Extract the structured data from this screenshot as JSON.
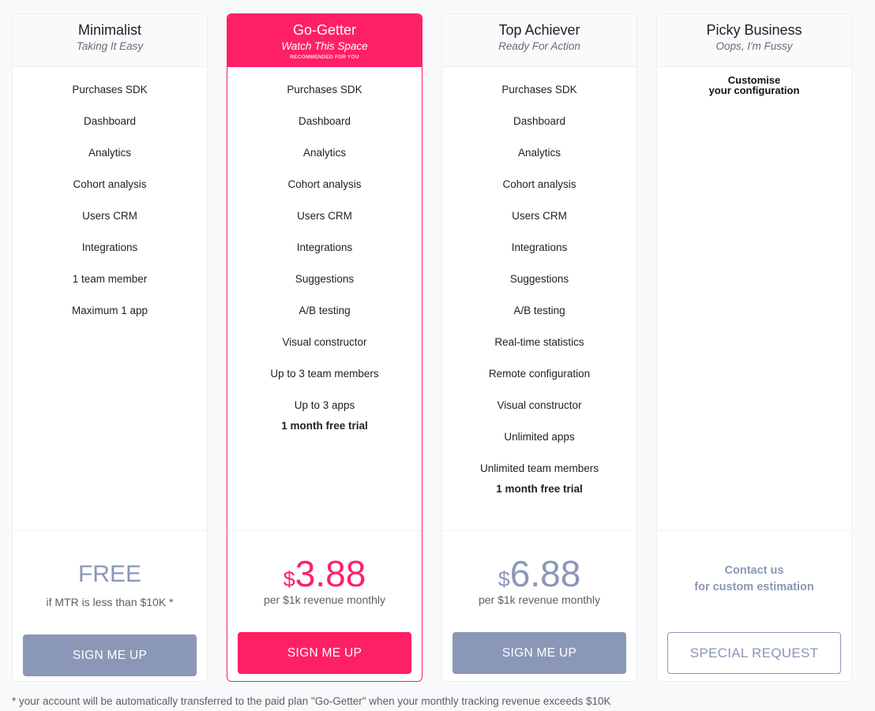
{
  "colors": {
    "accent": "#fe2065",
    "muted": "#8a97b6"
  },
  "plans": [
    {
      "name": "Minimalist",
      "tagline": "Taking It Easy",
      "features": [
        "Purchases SDK",
        "Dashboard",
        "Analytics",
        "Cohort analysis",
        "Users CRM",
        "Integrations",
        "1 team member",
        "Maximum 1 app"
      ],
      "price": "FREE",
      "price_note": "if MTR is less than $10K *",
      "button": "SIGN ME UP"
    },
    {
      "name": "Go-Getter",
      "tagline": "Watch This Space",
      "badge": "RECOMMENDED FOR YOU",
      "features": [
        "Purchases SDK",
        "Dashboard",
        "Analytics",
        "Cohort analysis",
        "Users CRM",
        "Integrations",
        "Suggestions",
        "A/B testing",
        "Visual constructor",
        "Up to 3 team members",
        "Up to 3 apps"
      ],
      "trial": "1 month free trial",
      "currency": "$",
      "price": "3.88",
      "price_note": "per $1k revenue monthly",
      "button": "SIGN ME UP"
    },
    {
      "name": "Top Achiever",
      "tagline": "Ready For Action",
      "features": [
        "Purchases SDK",
        "Dashboard",
        "Analytics",
        "Cohort analysis",
        "Users CRM",
        "Integrations",
        "Suggestions",
        "A/B testing",
        "Real-time statistics",
        "Remote configuration",
        "Visual constructor",
        "Unlimited apps",
        "Unlimited team members"
      ],
      "trial": "1 month free trial",
      "currency": "$",
      "price": "6.88",
      "price_note": "per $1k revenue monthly",
      "button": "SIGN ME UP"
    },
    {
      "name": "Picky Business",
      "tagline": "Oops, I'm Fussy",
      "custom_line1": "Customise",
      "custom_line2": "your configuration",
      "contact_line1": "Contact us",
      "contact_line2": "for custom estimation",
      "button": "SPECIAL REQUEST"
    }
  ],
  "footnote": "* your account will be automatically transferred to the paid plan \"Go-Getter\" when your monthly tracking revenue exceeds $10K"
}
